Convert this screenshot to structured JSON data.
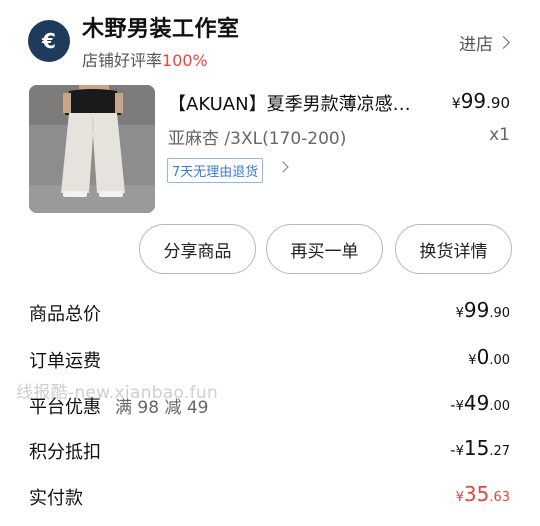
{
  "store": {
    "logo_char": "€",
    "name": "木野男装工作室",
    "rating_label": "店铺好评率",
    "rating_value": "100%",
    "visit_label": "进店"
  },
  "product": {
    "title": "【AKUAN】夏季男款薄凉感…",
    "price_currency": "¥",
    "price_int": "99",
    "price_dec": ".90",
    "spec": "亚麻杏 /3XL(170-200)",
    "quantity": "x1",
    "return_tag": "7天无理由退货"
  },
  "actions": {
    "share": "分享商品",
    "rebuy": "再买一单",
    "exchange": "换货详情"
  },
  "summary": {
    "total": {
      "label": "商品总价",
      "sign": "",
      "currency": "¥",
      "int": "99",
      "dec": ".90"
    },
    "shipping": {
      "label": "订单运费",
      "sign": "",
      "currency": "¥",
      "int": "0",
      "dec": ".00"
    },
    "platform_discount": {
      "label": "平台优惠",
      "extra": "满 98 减 49",
      "sign": "-",
      "currency": "¥",
      "int": "49",
      "dec": ".00"
    },
    "points": {
      "label": "积分抵扣",
      "sign": "-",
      "currency": "¥",
      "int": "15",
      "dec": ".27"
    },
    "paid": {
      "label": "实付款",
      "sign": "",
      "currency": "¥",
      "int": "35",
      "dec": ".63"
    }
  },
  "watermark": "线报酷-new.xianbao.fun",
  "colors": {
    "accent_red": "#e8453c",
    "tag_blue": "#3a7be0",
    "logo_bg": "#1f3b5c"
  }
}
